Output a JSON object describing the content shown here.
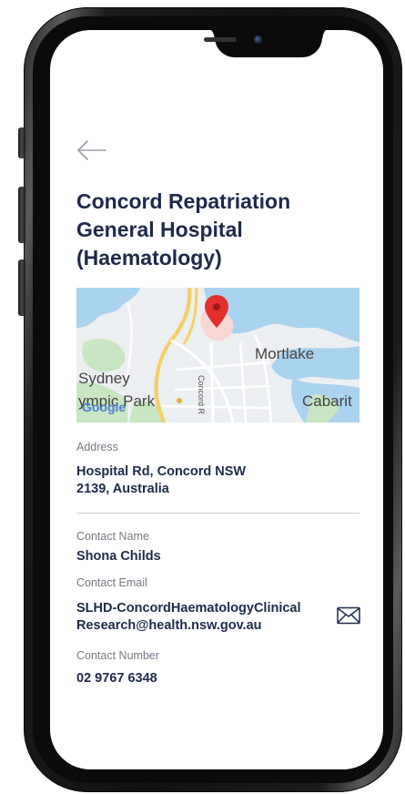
{
  "detail": {
    "title": "Concord Repatriation\nGeneral Hospital\n(Haematology)",
    "map": {
      "labels": [
        "Mortlake",
        "Sydney",
        "ympic Park",
        "Cabarit",
        "Concord R"
      ],
      "logo": "Google",
      "pin_color": "#e2312d",
      "water_color": "#a9d3f3",
      "land_color": "#e9eef1",
      "park_color": "#c9e6c4",
      "road_color": "#f5d36b"
    },
    "address_label": "Address",
    "address_value": "Hospital Rd, Concord NSW\n2139, Australia",
    "contact_name_label": "Contact Name",
    "contact_name_value": "Shona Childs",
    "contact_email_label": "Contact Email",
    "contact_email_value": "SLHD-ConcordHaematologyClinical\nResearch@health.nsw.gov.au",
    "contact_number_label": "Contact Number",
    "contact_number_value": "02 9767 6348"
  },
  "icons": {
    "back": "arrow-left-icon",
    "mail": "envelope-icon",
    "pin": "map-pin-icon"
  },
  "colors": {
    "heading": "#1e2a4a",
    "muted_label": "#757a85",
    "divider": "#c9ccd3"
  }
}
